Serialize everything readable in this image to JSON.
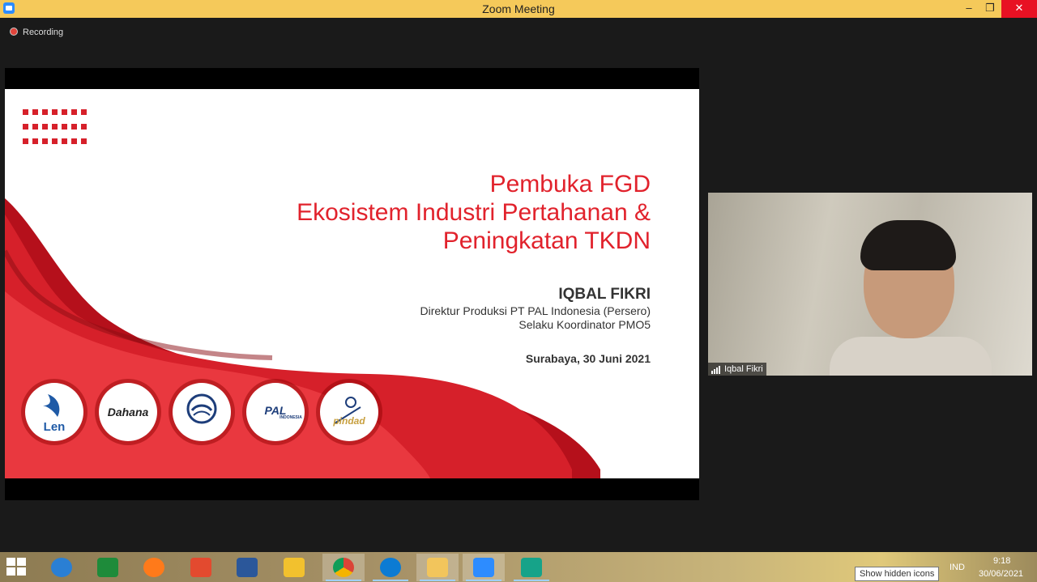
{
  "window": {
    "title": "Zoom Meeting",
    "minimize": "–",
    "maximize": "❐",
    "close": "✕"
  },
  "recording": {
    "label": "Recording"
  },
  "slide": {
    "title_lines": [
      "Pembuka FGD",
      "Ekosistem Industri Pertahanan &",
      "Peningkatan TKDN"
    ],
    "presenter_name": "IQBAL FIKRI",
    "role_line1": "Direktur Produksi PT PAL Indonesia (Persero)",
    "role_line2": "Selaku Koordinator PMO5",
    "place_date": "Surabaya, 30 Juni 2021",
    "logos": [
      "Len",
      "Dahana",
      "",
      "PAL",
      "pindad"
    ],
    "logo_subtext": {
      "pal": "INDONESIA"
    },
    "accent_color": "#e1222c"
  },
  "video": {
    "participant_name": "Iqbal Fikri"
  },
  "taskbar": {
    "apps": [
      "start-icon",
      "internet-explorer-icon",
      "store-icon",
      "firefox-icon",
      "adobe-icon",
      "word-icon",
      "sticky-notes-icon",
      "chrome-icon",
      "edge-icon",
      "file-explorer-icon",
      "zoom-icon",
      "app-icon"
    ],
    "language": "IND",
    "time": "9:18",
    "date": "30/06/2021",
    "tooltip": "Show hidden icons"
  }
}
